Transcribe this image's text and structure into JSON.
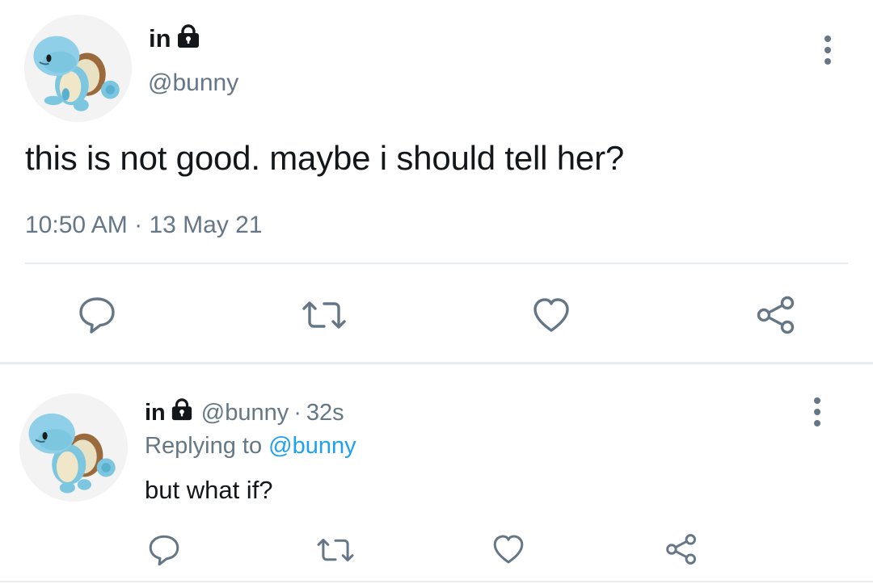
{
  "main_tweet": {
    "display_name": "in",
    "name_icon": "lock-icon",
    "handle": "@bunny",
    "text": "this is not good. maybe i should tell her?",
    "time": "10:50 AM",
    "separator": " · ",
    "date": "13 May 21",
    "actions": [
      "reply-icon",
      "retweet-icon",
      "like-icon",
      "share-icon"
    ]
  },
  "reply_tweet": {
    "display_name": "in",
    "name_icon": "lock-icon",
    "handle": "@bunny",
    "separator": "·",
    "age": "32s",
    "replying_prefix": "Replying to ",
    "replying_mention": "@bunny",
    "text": "but what if?",
    "actions": [
      "reply-icon",
      "retweet-icon",
      "like-icon",
      "share-icon"
    ]
  },
  "colors": {
    "text_primary": "#14171a",
    "text_secondary": "#657786",
    "link": "#1da1f2",
    "divider": "#e6ecf0",
    "icon": "#657786"
  }
}
